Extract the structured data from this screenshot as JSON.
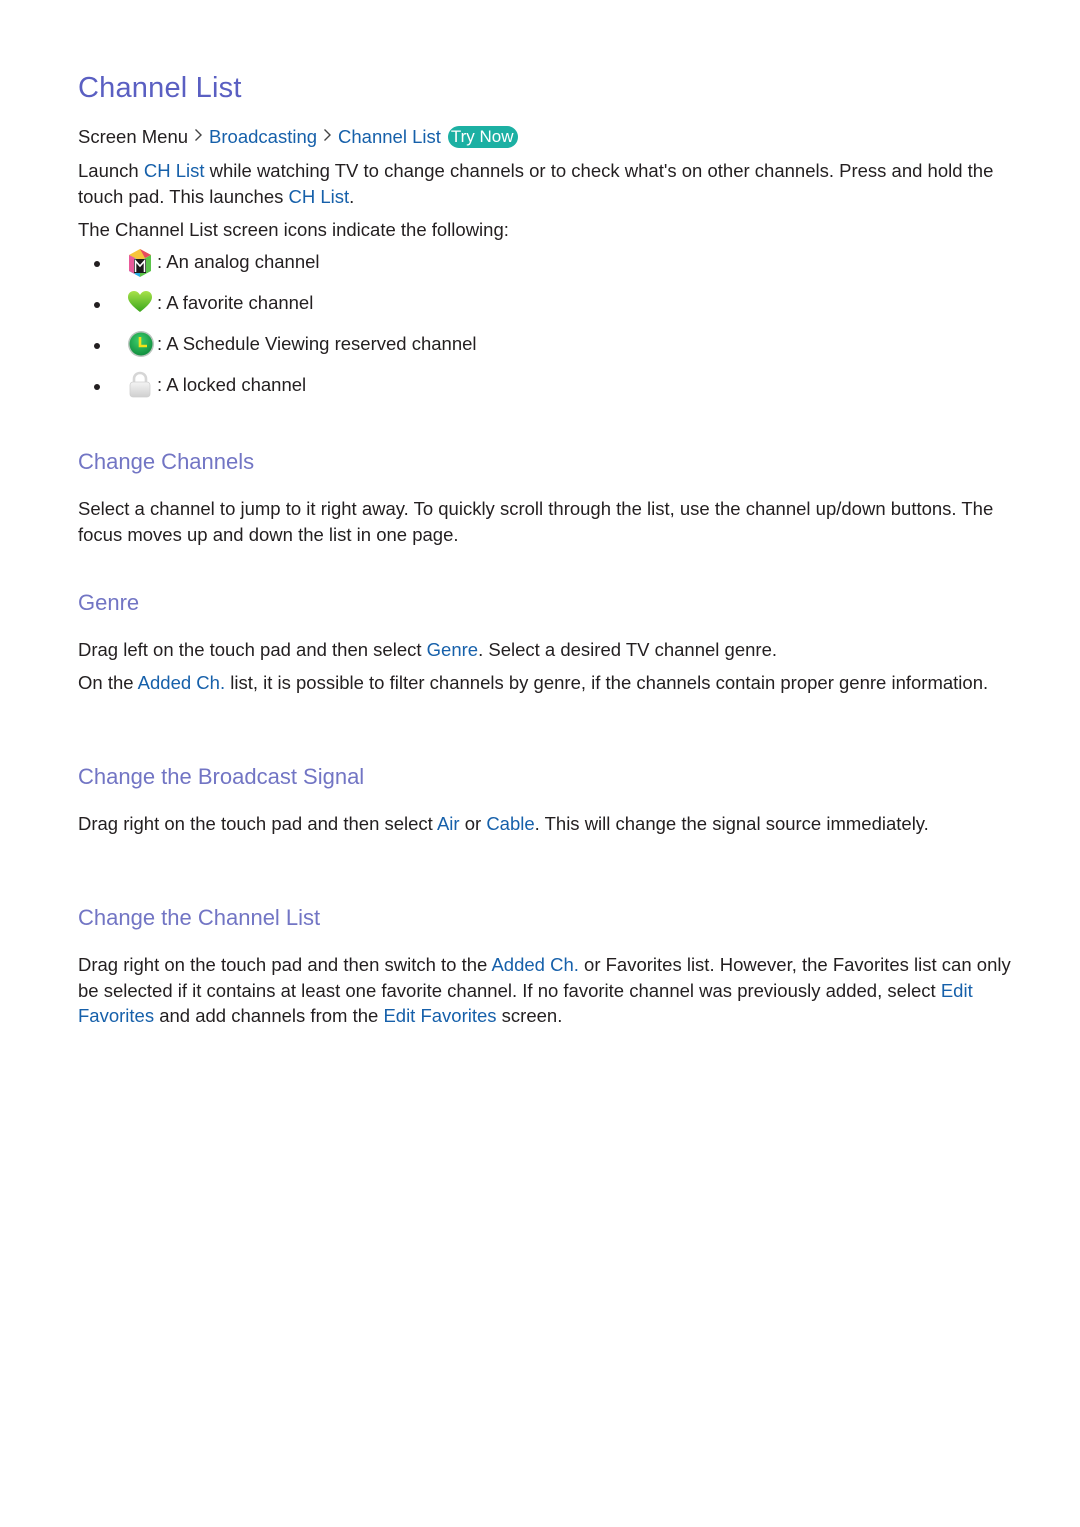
{
  "title": "Channel List",
  "breadcrumb": {
    "items": [
      "Screen Menu",
      "Broadcasting",
      "Channel List"
    ],
    "separator": ">",
    "try_now": "Try Now"
  },
  "intro": {
    "p1": {
      "t1": "Launch ",
      "link1": "CH List",
      "t2": " while watching TV to change channels or to check what's on other channels. Press and hold the touch pad. This launches ",
      "link2": "CH List",
      "t3": "."
    },
    "p2": "The Channel List screen icons indicate the following:"
  },
  "icon_list": [
    {
      "icon": "analog-channel-icon",
      "text": ": An analog channel"
    },
    {
      "icon": "favorite-heart-icon",
      "text": ": A favorite channel"
    },
    {
      "icon": "schedule-clock-icon",
      "text": ": A Schedule Viewing reserved channel"
    },
    {
      "icon": "lock-icon",
      "text": ": A locked channel"
    }
  ],
  "sections": {
    "change_channels": {
      "heading": "Change Channels",
      "text": "Select a channel to jump to it right away. To quickly scroll through the list, use the channel up/down buttons. The focus moves up and down the list in one page."
    },
    "genre": {
      "heading": "Genre",
      "p1": {
        "t1": "Drag left on the touch pad and then select ",
        "link1": "Genre",
        "t2": ". Select a desired TV channel genre."
      },
      "p2": {
        "t1": "On the ",
        "link1": "Added Ch.",
        "t2": " list, it is possible to filter channels by genre, if the channels contain proper genre information."
      }
    },
    "broadcast_signal": {
      "heading": "Change the Broadcast Signal",
      "p1": {
        "t1": "Drag right on the touch pad and then select ",
        "link1": "Air",
        "t2": " or ",
        "link2": "Cable",
        "t3": ". This will change the signal source immediately."
      }
    },
    "channel_list": {
      "heading": "Change the Channel List",
      "p1": {
        "t1": "Drag right on the touch pad and then switch to the ",
        "link1": "Added Ch.",
        "t2": " or Favorites list. However, the Favorites list can only be selected if it contains at least one favorite channel. If no favorite channel was previously added, select ",
        "link2": "Edit Favorites",
        "t3": " and add channels from the ",
        "link3": "Edit Favorites",
        "t4": " screen."
      }
    }
  },
  "colors": {
    "title": "#5a5fc2",
    "heading": "#7275c4",
    "link": "#1660aa",
    "try_now_bg": "#1cb0a3"
  }
}
